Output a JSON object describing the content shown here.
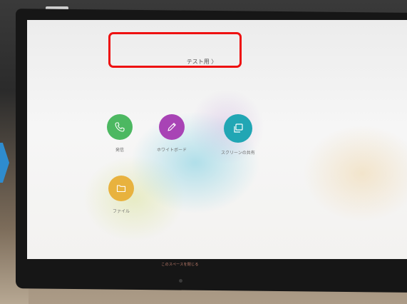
{
  "screen": {
    "space_title": "テスト用 〉",
    "apps": [
      {
        "id": "call",
        "label": "発信",
        "color": "#4cb861",
        "icon": "phone-icon"
      },
      {
        "id": "whiteboard",
        "label": "ホワイトボード",
        "color": "#a843b5",
        "icon": "pencil-icon"
      },
      {
        "id": "screen-share",
        "label": "スクリーンの共有",
        "color": "#21a6b4",
        "icon": "screen-share-icon"
      },
      {
        "id": "files",
        "label": "ファイル",
        "color": "#e8b23e",
        "icon": "folder-icon"
      }
    ],
    "close_space_label": "このスペースを閉じる"
  },
  "highlight_color": "#ee1111",
  "accent_arrow_color": "#2e8ccf"
}
